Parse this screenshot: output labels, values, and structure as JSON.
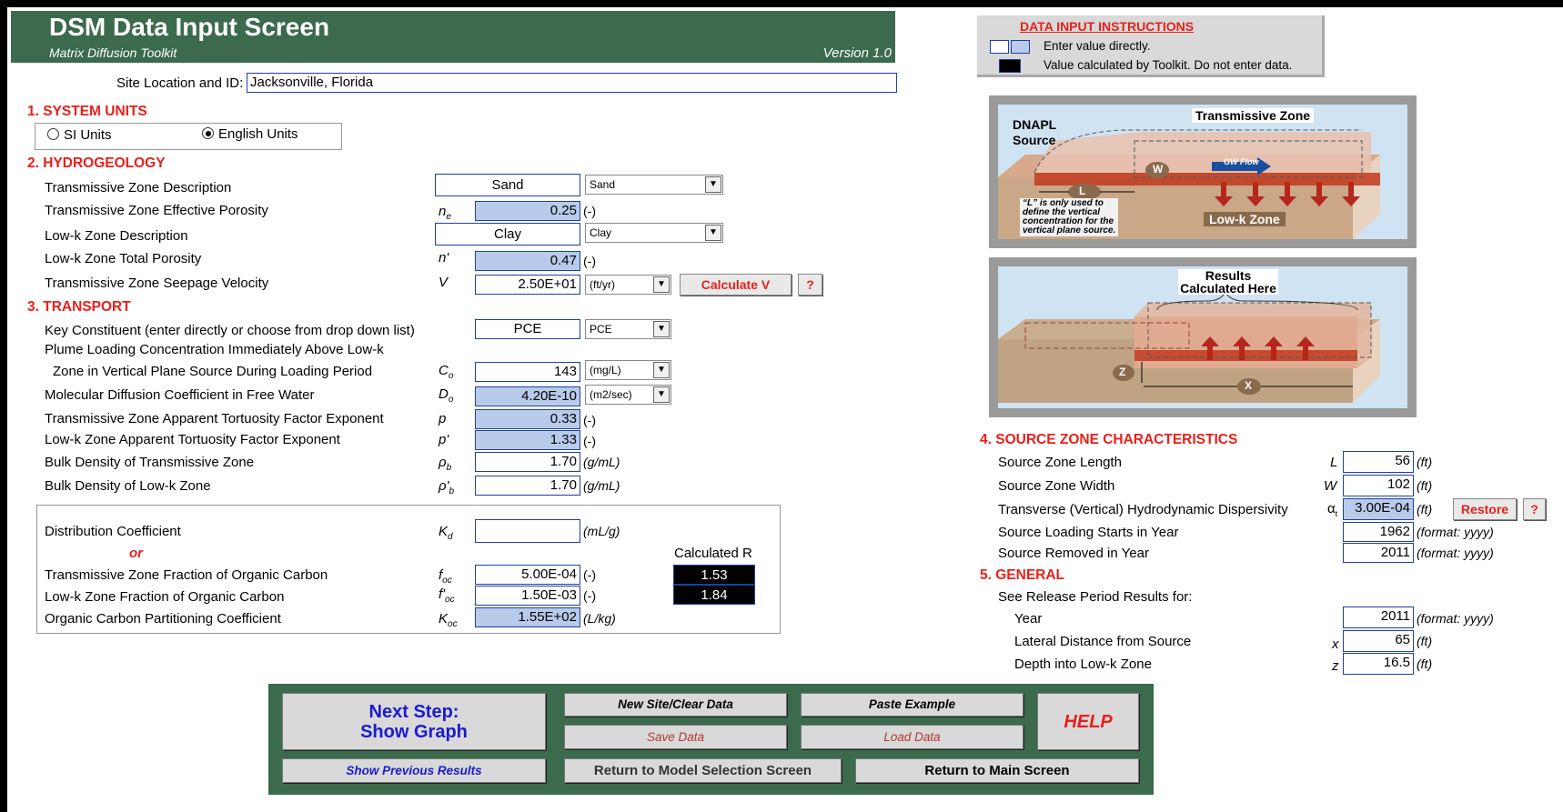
{
  "header": {
    "title": "DSM Data Input Screen",
    "subtitle": "Matrix Diffusion Toolkit",
    "version": "Version 1.0"
  },
  "site": {
    "label": "Site Location and ID:",
    "value": "Jacksonville, Florida"
  },
  "units": {
    "heading": "1.  SYSTEM UNITS",
    "si_label": "SI Units",
    "english_label": "English Units",
    "selected": "English Units"
  },
  "hydro": {
    "heading": "2.  HYDROGEOLOGY",
    "trans_desc": {
      "label": "Transmissive Zone Description",
      "value": "Sand",
      "select": "Sand"
    },
    "trans_porosity": {
      "label": "Transmissive Zone Effective Porosity",
      "sym": "n",
      "sub": "e",
      "value": "0.25",
      "unit": "(-)"
    },
    "lowk_desc": {
      "label": "Low-k Zone Description",
      "value": "Clay",
      "select": "Clay"
    },
    "lowk_porosity": {
      "label": "Low-k Zone Total Porosity",
      "sym": "n'",
      "value": "0.47",
      "unit": "(-)"
    },
    "velocity": {
      "label": "Transmissive Zone Seepage Velocity",
      "sym": "V",
      "value": "2.50E+01",
      "select": "(ft/yr)",
      "button": "Calculate V",
      "help": "?"
    }
  },
  "transport": {
    "heading": "3.  TRANSPORT",
    "constituent": {
      "label": "Key Constituent (enter directly or choose from drop down list)",
      "value": "PCE",
      "select": "PCE"
    },
    "plume_line1": "Plume Loading Concentration Immediately Above Low-k",
    "plume_line2": "Zone in Vertical Plane Source During Loading Period",
    "co": {
      "sym": "C",
      "sub": "o",
      "value": "143",
      "select": "(mg/L)"
    },
    "diffusion": {
      "label": "Molecular Diffusion Coefficient in Free Water",
      "sym": "D",
      "sub": "o",
      "value": "4.20E-10",
      "select": "(m2/sec)"
    },
    "tort_trans": {
      "label": "Transmissive Zone Apparent Tortuosity Factor Exponent",
      "sym": "p",
      "value": "0.33",
      "unit": "(-)"
    },
    "tort_lowk": {
      "label": "Low-k Zone Apparent Tortuosity Factor Exponent",
      "sym": "p'",
      "value": "1.33",
      "unit": "(-)"
    },
    "bulk_trans": {
      "label": "Bulk Density of Transmissive Zone",
      "sym": "ρ",
      "sub": "b",
      "value": "1.70",
      "unit": "(g/mL)"
    },
    "bulk_lowk": {
      "label": "Bulk Density of Low-k Zone",
      "sym": "ρ'",
      "sub": "b",
      "value": "1.70",
      "unit": "(g/mL)"
    },
    "kd": {
      "label": "Distribution Coefficient",
      "sym": "K",
      "sub": "d",
      "value": "",
      "unit": "(mL/g)"
    },
    "or": "or",
    "calc_r_label": "Calculated R",
    "foc_trans": {
      "label": "Transmissive Zone Fraction of Organic Carbon",
      "sym": "f",
      "sub": "oc",
      "value": "5.00E-04",
      "unit": "(-)",
      "r": "1.53"
    },
    "foc_lowk": {
      "label": "Low-k Zone Fraction of Organic Carbon",
      "sym": "f'",
      "sub": "oc",
      "value": "1.50E-03",
      "unit": "(-)",
      "r": "1.84"
    },
    "koc": {
      "label": "Organic Carbon Partitioning Coefficient",
      "sym": "K",
      "sub": "oc",
      "value": "1.55E+02",
      "unit": "(L/kg)"
    }
  },
  "instructions": {
    "title": "DATA  INPUT  INSTRUCTIONS",
    "line1": "Enter value directly.",
    "line2": "Value calculated by Toolkit. Do not enter data."
  },
  "diagram1": {
    "dnapl": "DNAPL",
    "source": "Source",
    "trans_zone": "Transmissive Zone",
    "gw_flow": "GW Flow",
    "lowk_zone": "Low-k Zone",
    "note_l1": "“L” is only used to",
    "note_l2": "define the vertical",
    "note_l3": "concentration for the",
    "note_l4": "vertical plane source.",
    "l": "L",
    "w": "W"
  },
  "diagram2": {
    "results_l1": "Results",
    "results_l2": "Calculated Here",
    "z": "Z",
    "x": "X"
  },
  "source": {
    "heading": "4.  SOURCE ZONE CHARACTERISTICS",
    "length": {
      "label": "Source Zone Length",
      "sym": "L",
      "value": "56",
      "unit": "(ft)"
    },
    "width": {
      "label": "Source Zone Width",
      "sym": "W",
      "value": "102",
      "unit": "(ft)"
    },
    "dispersivity": {
      "label": "Transverse (Vertical) Hydrodynamic Dispersivity",
      "sym": "α",
      "sub": "t",
      "value": "3.00E-04",
      "unit": "(ft)",
      "button": "Restore",
      "help": "?"
    },
    "start": {
      "label": "Source Loading Starts in Year",
      "value": "1962",
      "unit": "(format: yyyy)"
    },
    "removed": {
      "label": "Source Removed in Year",
      "value": "2011",
      "unit": "(format: yyyy)"
    }
  },
  "general": {
    "heading": "5.  GENERAL",
    "see": "See Release Period Results for:",
    "year": {
      "label": "Year",
      "value": "2011",
      "unit": "(format: yyyy)"
    },
    "lateral": {
      "label": "Lateral Distance from Source",
      "sym": "x",
      "value": "65",
      "unit": "(ft)"
    },
    "depth": {
      "label": "Depth into Low-k Zone",
      "sym": "z",
      "value": "16.5",
      "unit": "(ft)"
    }
  },
  "nav": {
    "next_l1": "Next Step:",
    "next_l2": "Show Graph",
    "new_site": "New Site/Clear Data",
    "paste": "Paste Example",
    "help": "HELP",
    "save": "Save Data",
    "load": "Load Data",
    "previous": "Show Previous  Results",
    "model_sel": "Return to Model Selection Screen",
    "main": "Return to Main Screen"
  },
  "colors": {
    "header_green": "#3b6a4c",
    "section_red": "#e8201a",
    "calc_blue": "#b8cbea",
    "input_border": "#1f3fa3",
    "nav_blue": "#1a1ad0"
  }
}
